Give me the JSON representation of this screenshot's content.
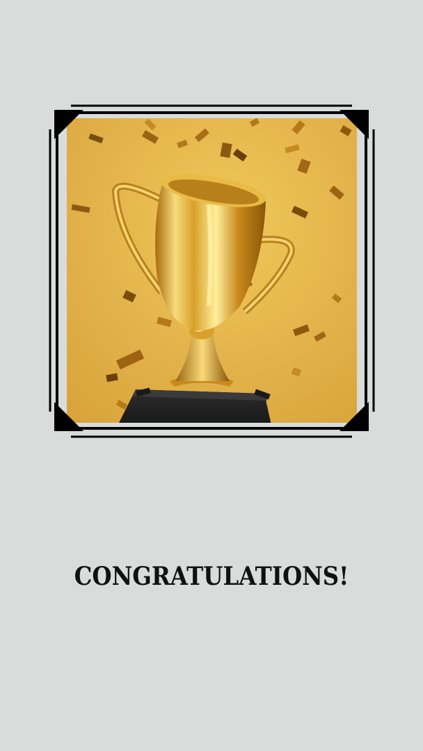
{
  "title": "CONGRATULATIONS!",
  "photo": {
    "subject": "gold-trophy-with-confetti"
  },
  "colors": {
    "background": "#d9dcdb",
    "photo_bg": "#e0b54a",
    "trophy_gold": "#d9a21f",
    "frame": "#000000"
  }
}
